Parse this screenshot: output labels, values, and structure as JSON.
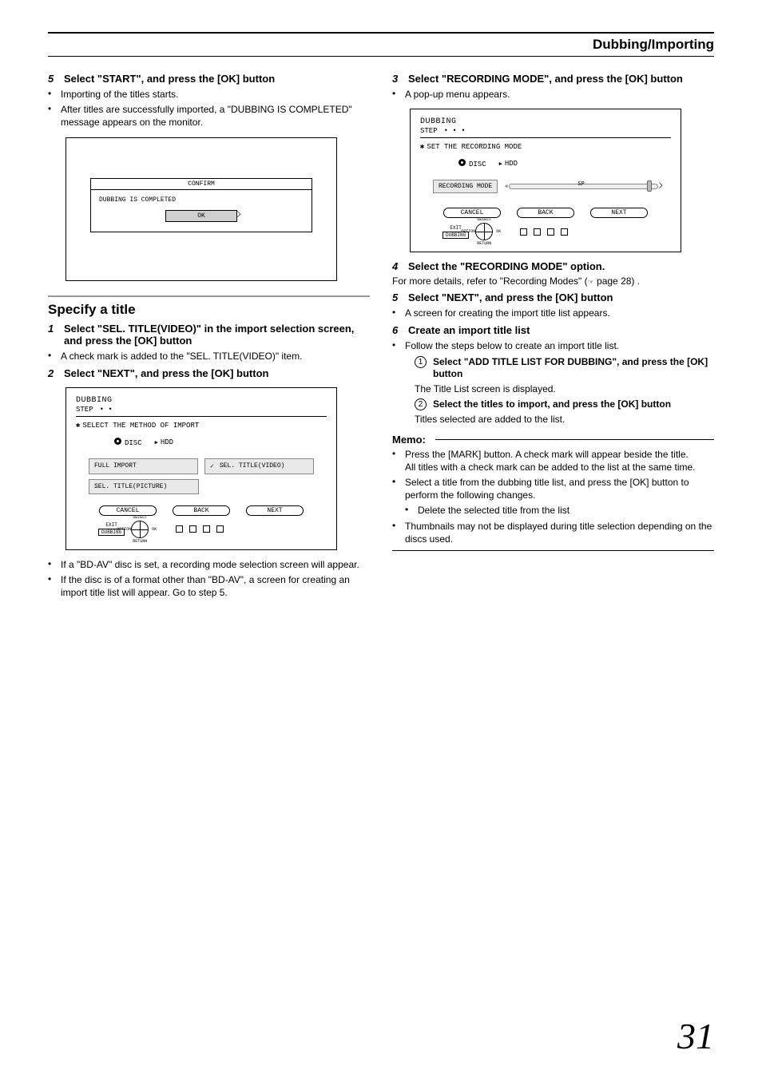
{
  "header": {
    "title": "Dubbing/Importing"
  },
  "left": {
    "step5": {
      "num": "5",
      "text": "Select \"START\", and press the [OK] button"
    },
    "b1": "Importing of the titles starts.",
    "b2": "After titles are successfully imported, a \"DUBBING IS COMPLETED\" message appears on the monitor.",
    "confirm": {
      "title": "CONFIRM",
      "msg": "DUBBING IS COMPLETED",
      "ok": "OK"
    },
    "specify_title": "Specify a title",
    "step1": {
      "num": "1",
      "text": "Select \"SEL. TITLE(VIDEO)\" in the import selection screen, and press the [OK] button"
    },
    "b3": "A check mark is added to the \"SEL. TITLE(VIDEO)\" item.",
    "step2": {
      "num": "2",
      "text": "Select \"NEXT\", and press the [OK] button"
    },
    "dub2": {
      "title": "DUBBING",
      "step": "STEP",
      "dots": "• •",
      "subhead": "SELECT THE METHOD OF IMPORT",
      "disc": "DISC",
      "hdd": "HDD",
      "full": "FULL IMPORT",
      "selvid": "SEL. TITLE(VIDEO)",
      "selpic": "SEL. TITLE(PICTURE)",
      "cancel": "CANCEL",
      "back": "BACK",
      "next": "NEXT",
      "exit": "EXIT",
      "dubbing": "DUBBING",
      "dpad_top": "SELECT",
      "dpad_r": "OK",
      "dpad_b": "RETURN",
      "dpad_l": "OPTION"
    },
    "b4": "If a \"BD-AV\" disc is set, a recording mode selection screen will appear.",
    "b5": "If the disc is of a format other than \"BD-AV\", a screen for creating an import title list will appear. Go to step 5."
  },
  "right": {
    "step3": {
      "num": "3",
      "text": "Select \"RECORDING MODE\", and press the [OK] button"
    },
    "b1": "A pop-up menu appears.",
    "dub3": {
      "title": "DUBBING",
      "step": "STEP",
      "dots": "• • •",
      "subhead": "SET THE RECORDING MODE",
      "disc": "DISC",
      "hdd": "HDD",
      "recmode": "RECORDING MODE",
      "sp": "SP",
      "cancel": "CANCEL",
      "back": "BACK",
      "next": "NEXT",
      "exit": "EXIT",
      "dubbing": "DUBBING",
      "dpad_top": "SELECT",
      "dpad_r": "OK",
      "dpad_b": "RETURN",
      "dpad_l": "OPTION"
    },
    "step4": {
      "num": "4",
      "text": "Select the \"RECORDING MODE\" option."
    },
    "ref_a": "For more details, refer to \"Recording Modes\" (",
    "ref_b": " page 28) .",
    "step5": {
      "num": "5",
      "text": "Select \"NEXT\", and press the [OK] button"
    },
    "b2": "A screen for creating the import title list appears.",
    "step6": {
      "num": "6",
      "text": "Create an import title list"
    },
    "b3": "Follow the steps below to create an import title list.",
    "c1": "Select \"ADD TITLE LIST FOR DUBBING\", and press the [OK] button",
    "c1b": "The Title List screen is displayed.",
    "c2": "Select the titles to import, and press the [OK] button",
    "c2b": "Titles selected are added to the list.",
    "memo": "Memo:",
    "m1": "Press the [MARK] button. A check mark will appear beside the title.",
    "m1b": "All titles with a check mark can be added to the list at the same time.",
    "m2": "Select a title from the dubbing title list, and press the [OK] button to perform the following changes.",
    "m2s": "Delete the selected title from the list",
    "m3": "Thumbnails may not be displayed during title selection depending on the discs used."
  },
  "pagenum": "31"
}
